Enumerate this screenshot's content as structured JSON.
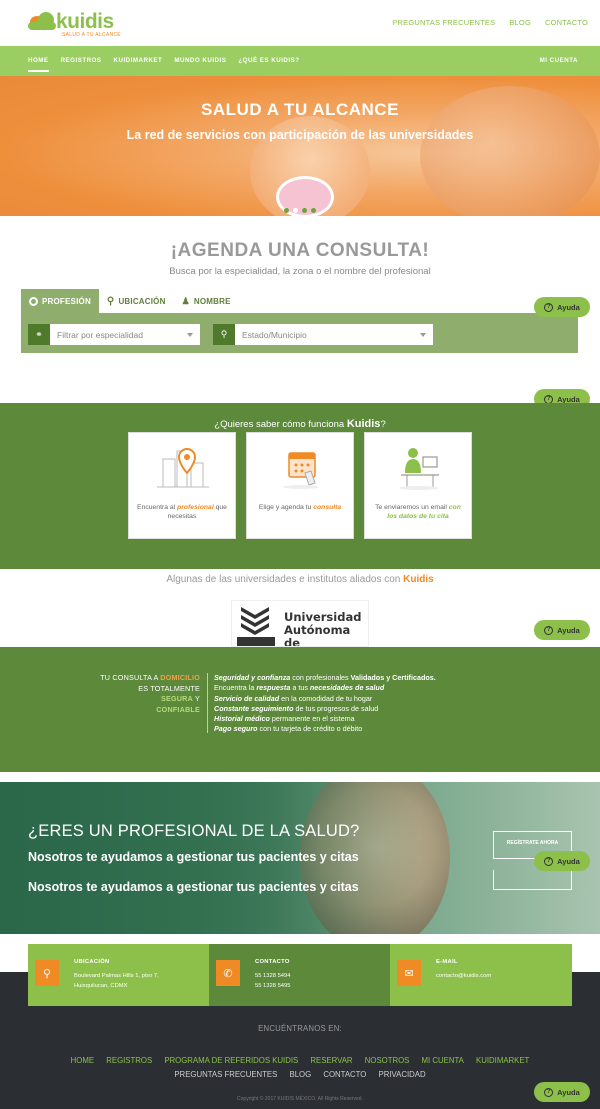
{
  "brand": {
    "name": "kuidis",
    "tagline": "SALUD A TU ALCANCE"
  },
  "toplinks": [
    "PREGUNTAS FRECUENTES",
    "BLOG",
    "CONTACTO"
  ],
  "nav": {
    "items": [
      "HOME",
      "REGISTROS",
      "KUIDIMARKET",
      "MUNDO KUIDIS",
      "¿QUÉ ES KUIDIS?"
    ],
    "account": "MI CUENTA"
  },
  "hero": {
    "title": "SALUD A TU ALCANCE",
    "subtitle": "La red de servicios con participación de las universidades"
  },
  "agenda": {
    "title": "¡AGENDA UNA CONSULTA!",
    "subtitle": "Busca por la especialidad, la zona o el nombre del profesional",
    "tabs": [
      "PROFESIÓN",
      "UBICACIÓN",
      "NOMBRE"
    ],
    "specialty_placeholder": "Filtrar por especialidad",
    "location_placeholder": "Estado/Municipio"
  },
  "help_label": "Ayuda",
  "how": {
    "title_prefix": "¿Quieres saber cómo funciona ",
    "title_brand": "Kuidis",
    "title_suffix": "?",
    "cards": [
      {
        "pre": "Encuentra al",
        "hl": "profesional",
        "post": "que necesitas"
      },
      {
        "pre": "Elige y agenda tu",
        "hl": "consulta",
        "post": ""
      },
      {
        "pre": "Te enviaremos un email",
        "hl": "con los datos de tu cita",
        "post": ""
      }
    ]
  },
  "universities": {
    "title_prefix": "Algunas de las universidades e institutos aliados con ",
    "title_brand": "Kuidis",
    "logo_name": "Universidad Autónoma de Guadalajara"
  },
  "benefits": {
    "left": {
      "l1a": "TU CONSULTA A ",
      "l1b": "DOMICILIO",
      "l2": "ES TOTALMENTE",
      "l3a": "SEGURA",
      "l3b": " Y",
      "l4": "CONFIABLE"
    },
    "right": [
      {
        "b": "Seguridad y confianza",
        "t": " con profesionales ",
        "b2": "Validados y Certificados."
      },
      {
        "t0": "Encuentra la ",
        "b": "respuesta",
        "t": " a tus ",
        "b2": "necesidades de salud"
      },
      {
        "b": "Servicio de calidad",
        "t": " en la comodidad de tu hogar"
      },
      {
        "b": "Constante seguimiento",
        "t": " de tus progresos de salud"
      },
      {
        "b": "Historial médico",
        "t": " permanente en el sistema"
      },
      {
        "b": "Pago seguro",
        "t": " con tu tarjeta de crédito o débito"
      }
    ]
  },
  "pro": {
    "title": "¿ERES UN PROFESIONAL DE LA SALUD?",
    "line1": "Nosotros te ayudamos a gestionar tus pacientes y citas",
    "line2": "Nosotros te ayudamos a gestionar tus pacientes y citas",
    "register": "REGÍSTRATE AHORA"
  },
  "contact": {
    "location": {
      "label": "UBICACIÓN",
      "line1": "Boulevard Palmas Hills 1, piso 7,",
      "line2": "Huixquilucan, CDMX"
    },
    "phone": {
      "label": "CONTACTO",
      "line1": "55 1328 5494",
      "line2": "55 1328 5495"
    },
    "email": {
      "label": "E-MAIL",
      "line1": "contacto@kuidis.com"
    }
  },
  "footer": {
    "follow": "ENCUÉNTRANOS EN:",
    "links1": [
      "HOME",
      "REGISTROS",
      "PROGRAMA DE REFERIDOS KUIDIS",
      "RESERVAR",
      "NOSOTROS",
      "MI CUENTA",
      "KUIDIMARKET"
    ],
    "links2": [
      "PREGUNTAS FRECUENTES",
      "BLOG",
      "CONTACTO",
      "PRIVACIDAD"
    ],
    "copyright": "Copyright © 2017 KUIDIS MÉXICO. All Rights Reserved."
  },
  "colors": {
    "green": "#8cc04a",
    "dark_green": "#5d893b",
    "orange": "#f08a24",
    "footer": "#2b2f33"
  }
}
